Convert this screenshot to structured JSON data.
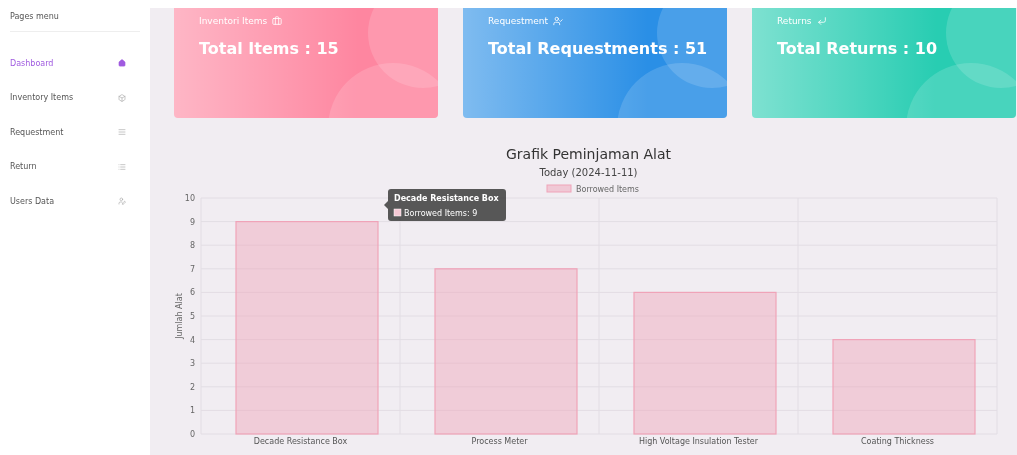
{
  "sidebar": {
    "heading": "Pages menu",
    "items": [
      {
        "label": "Dashboard",
        "selected": true
      },
      {
        "label": "Inventory Items",
        "selected": false
      },
      {
        "label": "Requestment",
        "selected": false
      },
      {
        "label": "Return",
        "selected": false
      },
      {
        "label": "Users Data",
        "selected": false
      }
    ]
  },
  "cards": [
    {
      "label": "Inventori Items",
      "value": "Total Items : 15",
      "color": "#fe86a0"
    },
    {
      "label": "Requestment",
      "value": "Total Requestments : 51",
      "color": "#2a8fe6"
    },
    {
      "label": "Returns",
      "value": "Total Returns : 10",
      "color": "#28cdb2"
    }
  ],
  "chart": {
    "subtitle": "Today (2024-11-11)",
    "tooltip": {
      "title": "Decade Resistance Box",
      "label": "Borrowed Items: 9"
    },
    "chart_data": {
      "type": "bar",
      "title": "Grafik Peminjaman Alat",
      "ylabel": "Jumlah Alat",
      "grid": true,
      "categories": [
        "Decade Resistance Box",
        "Process Meter",
        "High Voltage Insulation Tester",
        "Coating Thickness"
      ],
      "series": [
        {
          "name": "Borrowed Items",
          "color": "#f0a3b8",
          "values": [
            9,
            7,
            6,
            4
          ]
        }
      ],
      "ylim": [
        0,
        10
      ],
      "yticks": [
        0,
        1,
        2,
        3,
        4,
        5,
        6,
        7,
        8,
        9,
        10
      ]
    }
  }
}
